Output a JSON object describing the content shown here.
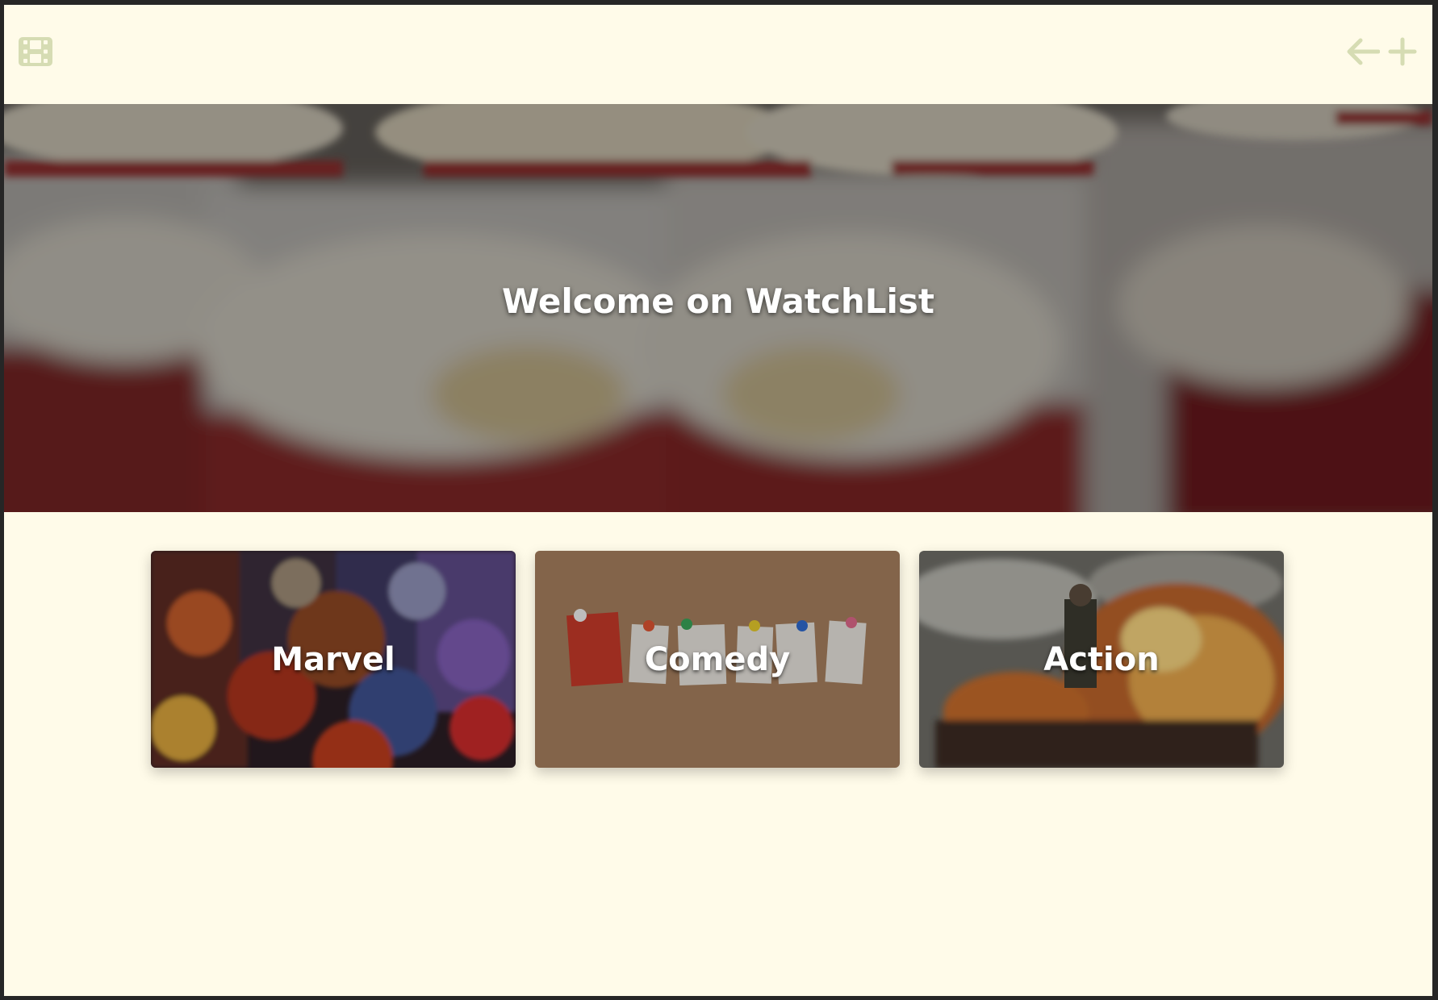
{
  "header": {
    "logo_icon": "film-icon",
    "back_icon": "arrow-left-icon",
    "add_icon": "plus-icon",
    "icon_color": "#d6dcb3"
  },
  "hero": {
    "title": "Welcome on WatchList",
    "background": "popcorn-photo"
  },
  "categories": [
    {
      "label": "Marvel",
      "background": "marvel-collage-photo"
    },
    {
      "label": "Comedy",
      "background": "cork-board-letters-photo"
    },
    {
      "label": "Action",
      "background": "explosion-car-photo"
    }
  ],
  "colors": {
    "page_background": "#fffbe9",
    "frame": "#262626"
  }
}
